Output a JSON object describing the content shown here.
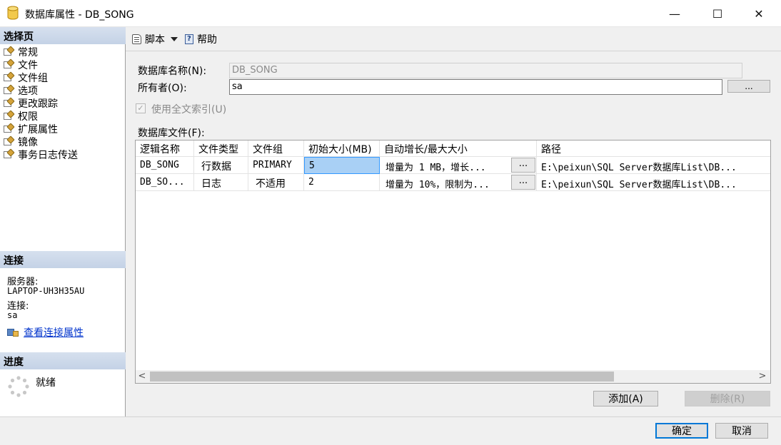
{
  "window": {
    "title": "数据库属性 - DB_SONG",
    "min": "—",
    "max": "☐",
    "close": "✕"
  },
  "sidebar": {
    "pages_header": "选择页",
    "pages": [
      "常规",
      "文件",
      "文件组",
      "选项",
      "更改跟踪",
      "权限",
      "扩展属性",
      "镜像",
      "事务日志传送"
    ],
    "connection_header": "连接",
    "server_label": "服务器:",
    "server_value": "LAPTOP-UH3H35AU",
    "connection_label": "连接:",
    "connection_value": "sa",
    "view_connection_link": "查看连接属性",
    "progress_header": "进度",
    "progress_status": "就绪"
  },
  "toolbar": {
    "script": "脚本",
    "help": "帮助"
  },
  "form": {
    "db_name_label": "数据库名称(N):",
    "db_name_value": "DB_SONG",
    "owner_label": "所有者(O):",
    "owner_value": "sa",
    "owner_browse": "...",
    "fulltext_label": "使用全文索引(U)",
    "files_label": "数据库文件(F):"
  },
  "grid": {
    "columns": [
      "逻辑名称",
      "文件类型",
      "文件组",
      "初始大小(MB)",
      "自动增长/最大大小",
      "路径"
    ],
    "rows": [
      [
        "DB_SONG",
        "行数据",
        "PRIMARY",
        "5",
        "增量为 1 MB，增长...",
        "E:\\peixun\\SQL Server数据库List\\DB..."
      ],
      [
        "DB_SO...",
        "日志",
        "不适用",
        "2",
        "增量为 10%，限制为...",
        "E:\\peixun\\SQL Server数据库List\\DB..."
      ]
    ],
    "ellipsis": "...",
    "scroll_left": "<",
    "scroll_right": ">"
  },
  "buttons": {
    "add": "添加(A)",
    "remove": "删除(R)",
    "ok": "确定",
    "cancel": "取消"
  }
}
